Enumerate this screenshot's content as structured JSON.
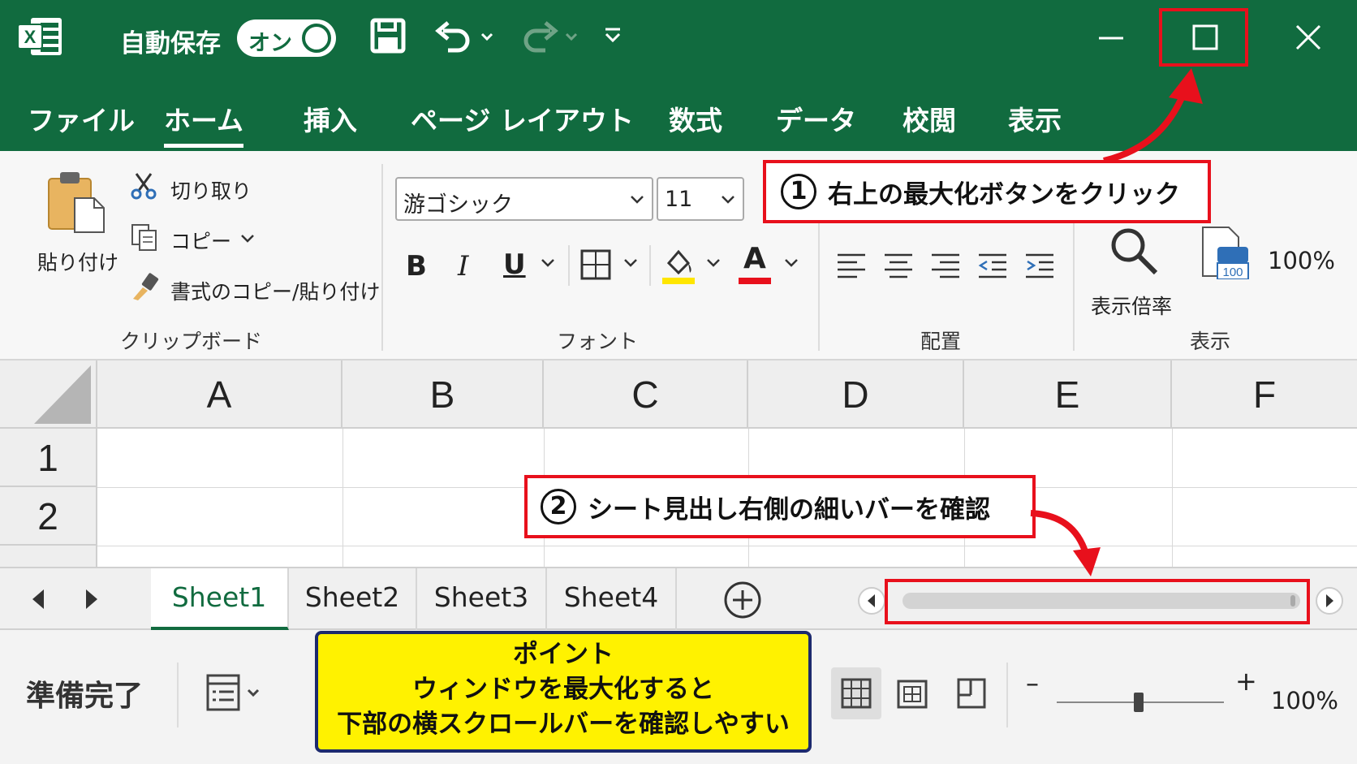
{
  "titlebar": {
    "autosave_label": "自動保存",
    "autosave_state": "オン",
    "accent_color": "#116b3f"
  },
  "tabs": [
    {
      "label": "ファイル"
    },
    {
      "label": "ホーム",
      "active": true
    },
    {
      "label": "挿入"
    },
    {
      "label": "ページ レイアウト"
    },
    {
      "label": "数式"
    },
    {
      "label": "データ"
    },
    {
      "label": "校閲"
    },
    {
      "label": "表示"
    }
  ],
  "ribbon": {
    "clipboard": {
      "paste": "貼り付け",
      "cut": "切り取り",
      "copy": "コピー",
      "format_painter": "書式のコピー/貼り付け",
      "group": "クリップボード"
    },
    "font": {
      "name": "游ゴシック",
      "size": "11",
      "bold": "B",
      "italic": "I",
      "underline": "U",
      "font_color_letter": "A",
      "group": "フォント"
    },
    "alignment": {
      "group": "配置"
    },
    "view": {
      "zoom": "表示倍率",
      "zoom_100_icon_text": "100",
      "zoom_value": "100%",
      "group": "表示"
    }
  },
  "grid": {
    "columns": [
      "A",
      "B",
      "C",
      "D",
      "E",
      "F"
    ],
    "rows": [
      "1",
      "2"
    ]
  },
  "sheets": [
    {
      "name": "Sheet1",
      "active": true
    },
    {
      "name": "Sheet2"
    },
    {
      "name": "Sheet3"
    },
    {
      "name": "Sheet4"
    }
  ],
  "status": {
    "ready": "準備完了",
    "zoom_minus": "–",
    "zoom_plus": "+",
    "zoom": "100%"
  },
  "annotations": {
    "step1_num": "1",
    "step1_text": "右上の最大化ボタンをクリック",
    "step2_num": "2",
    "step2_text": "シート見出し右側の細いバーを確認",
    "point_title": "ポイント",
    "point_line1": "ウィンドウを最大化すると",
    "point_line2": "下部の横スクロールバーを確認しやすい",
    "highlight_color": "#e8101c",
    "point_bg": "#fff200"
  }
}
